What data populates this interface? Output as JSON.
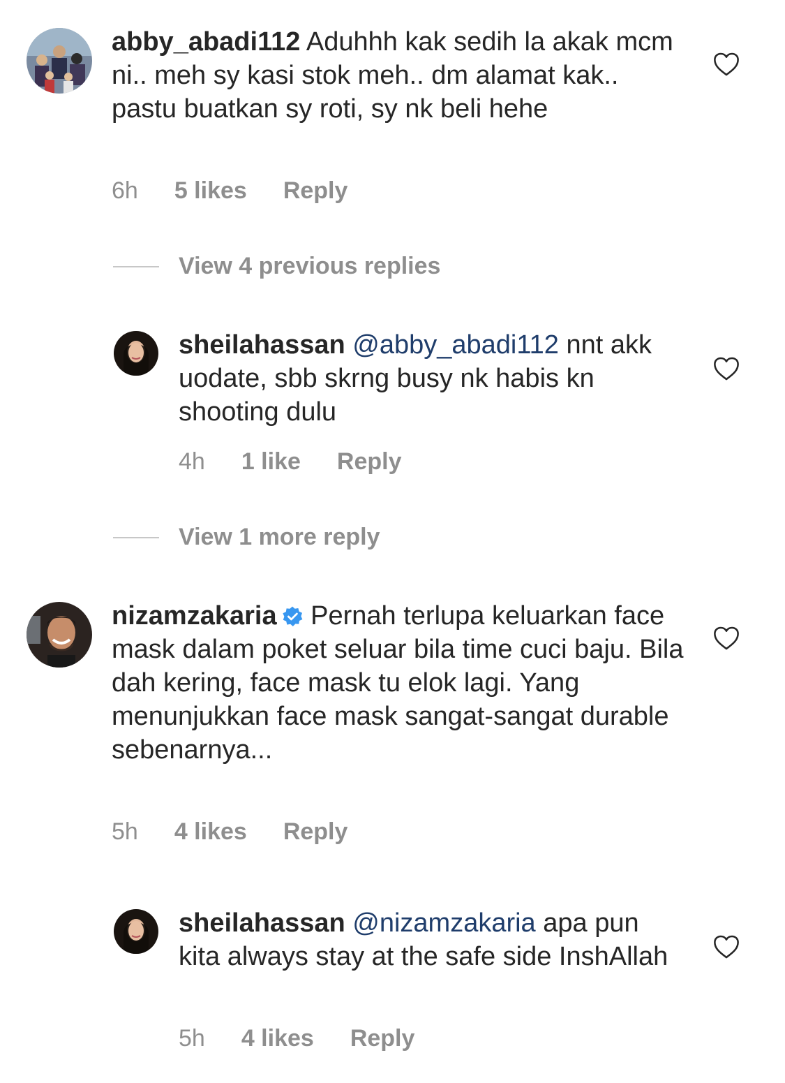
{
  "comments": [
    {
      "username": "abby_abadi112",
      "verified": false,
      "mention": "",
      "text": "Aduhhh kak sedih la akak mcm ni.. meh sy kasi stok meh.. dm alamat kak.. pastu buatkan sy roti, sy nk beli hehe",
      "time": "6h",
      "likes": "5 likes",
      "reply_label": "Reply"
    },
    {
      "username": "sheilahassan",
      "verified": false,
      "mention": "@abby_abadi112",
      "text": "nnt akk uodate, sbb skrng busy nk habis kn shooting dulu",
      "time": "4h",
      "likes": "1 like",
      "reply_label": "Reply"
    },
    {
      "username": "nizamzakaria",
      "verified": true,
      "mention": "",
      "text": "Pernah terlupa keluarkan face mask dalam poket seluar bila time cuci baju. Bila dah kering, face mask tu elok lagi. Yang menunjukkan face mask sangat-sangat durable sebenarnya...",
      "time": "5h",
      "likes": "4 likes",
      "reply_label": "Reply"
    },
    {
      "username": "sheilahassan",
      "verified": false,
      "mention": "@nizamzakaria",
      "text": "apa pun kita always stay at the safe side InshAllah",
      "time": "5h",
      "likes": "4 likes",
      "reply_label": "Reply"
    }
  ],
  "view_replies": [
    {
      "label": "View 4 previous replies"
    },
    {
      "label": "View 1 more reply"
    }
  ],
  "icons": {
    "like": "heart-outline-icon",
    "verified": "verified-badge-icon"
  },
  "colors": {
    "text": "#262626",
    "secondary": "#8e8e8e",
    "mention": "#1f3d6b",
    "verified": "#3897f0"
  }
}
